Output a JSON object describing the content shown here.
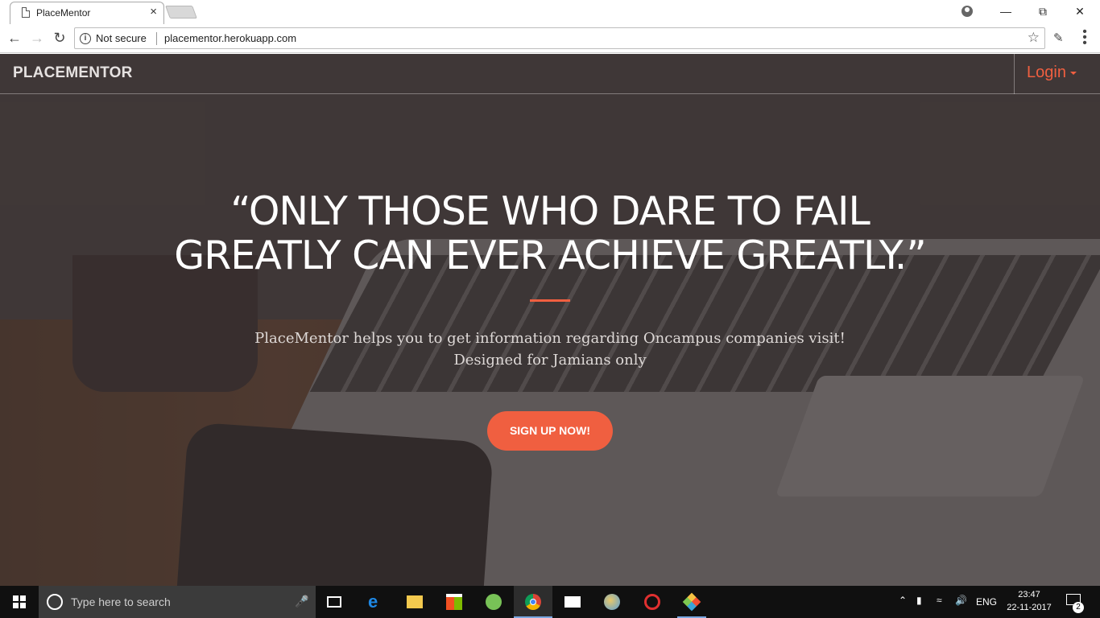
{
  "browser": {
    "tab_title": "PlaceMentor",
    "tab_close": "×",
    "security_label": "Not secure",
    "url": "placementor.herokuapp.com"
  },
  "site": {
    "brand": "PLACEMENTOR",
    "login_label": "Login",
    "headline_line1": "“ONLY THOSE WHO DARE TO FAIL",
    "headline_line2": "GREATLY CAN EVER ACHIEVE GREATLY.”",
    "subtitle_line1": "PlaceMentor helps you to get information regarding Oncampus companies visit!",
    "subtitle_line2": "Designed for Jamians only",
    "cta_label": "SIGN UP NOW!",
    "accent_color": "#f05f40"
  },
  "taskbar": {
    "search_placeholder": "Type here to search",
    "language": "ENG",
    "time": "23:47",
    "date": "22-11-2017",
    "notification_count": "2",
    "pinned_icons": [
      "task-view-icon",
      "edge-icon",
      "file-explorer-icon",
      "store-icon",
      "android-studio-icon",
      "chrome-icon",
      "mail-icon",
      "paint-icon",
      "git-gui-icon",
      "git-icon"
    ]
  }
}
